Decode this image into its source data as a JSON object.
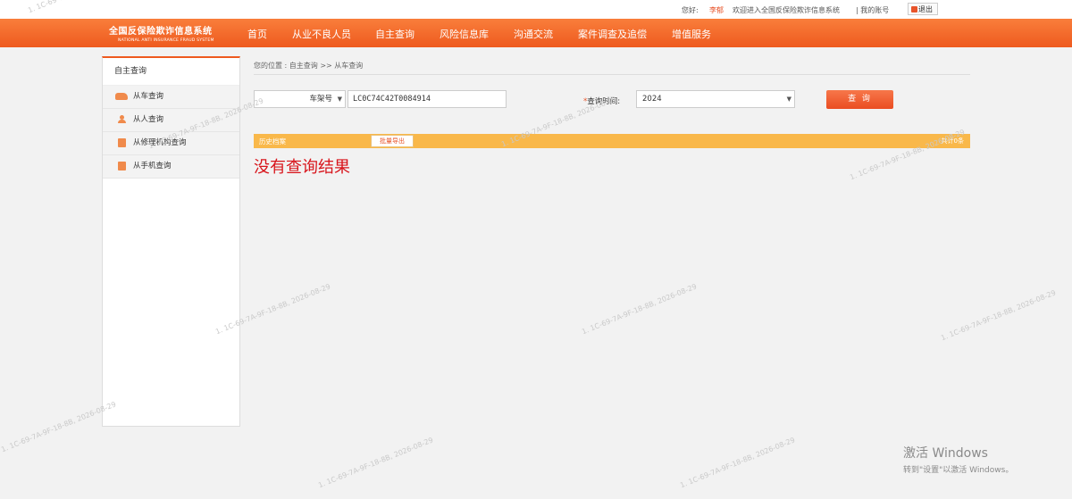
{
  "topbar": {
    "greeting": "您好:",
    "username": "李郁",
    "welcome": "欢迎进入全国反保险欺诈信息系统",
    "my_account": "| 我的账号",
    "logout": "退出"
  },
  "brand": {
    "title_cn": "全国反保险欺诈信息系统",
    "title_en": "NATIONAL ANTI INSURANCE FRAUD SYSTEM"
  },
  "nav": [
    "首页",
    "从业不良人员",
    "自主查询",
    "风险信息库",
    "沟通交流",
    "案件调查及追偿",
    "增值服务"
  ],
  "sidebar": {
    "title": "自主查询",
    "items": [
      {
        "label": "从车查询",
        "icon": "car-icon"
      },
      {
        "label": "从人查询",
        "icon": "person-icon"
      },
      {
        "label": "从修理机构查询",
        "icon": "document-icon"
      },
      {
        "label": "从手机查询",
        "icon": "document-icon"
      }
    ]
  },
  "breadcrumb": "您的位置 : 自主查询 >> 从车查询",
  "search": {
    "type_value": "车架号",
    "vin_value": "LC0C74C42T0084914",
    "time_star": "*",
    "time_label": "查询时间:",
    "year_value": "2024",
    "query_button": "查 询"
  },
  "history": {
    "label": "历史档案",
    "export_button": "批量导出",
    "count": "共计0条"
  },
  "result_message": "没有查询结果",
  "windows_activation": {
    "line1": "激活 Windows",
    "line2": "转到\"设置\"以激活 Windows。"
  },
  "watermark": "1. 1C-69-7A-9F-18-8B, 2026-08-29",
  "colors": {
    "brand_orange": "#ee5a1f",
    "history_bar": "#f9b84a",
    "no_result_red": "#d8141b"
  }
}
